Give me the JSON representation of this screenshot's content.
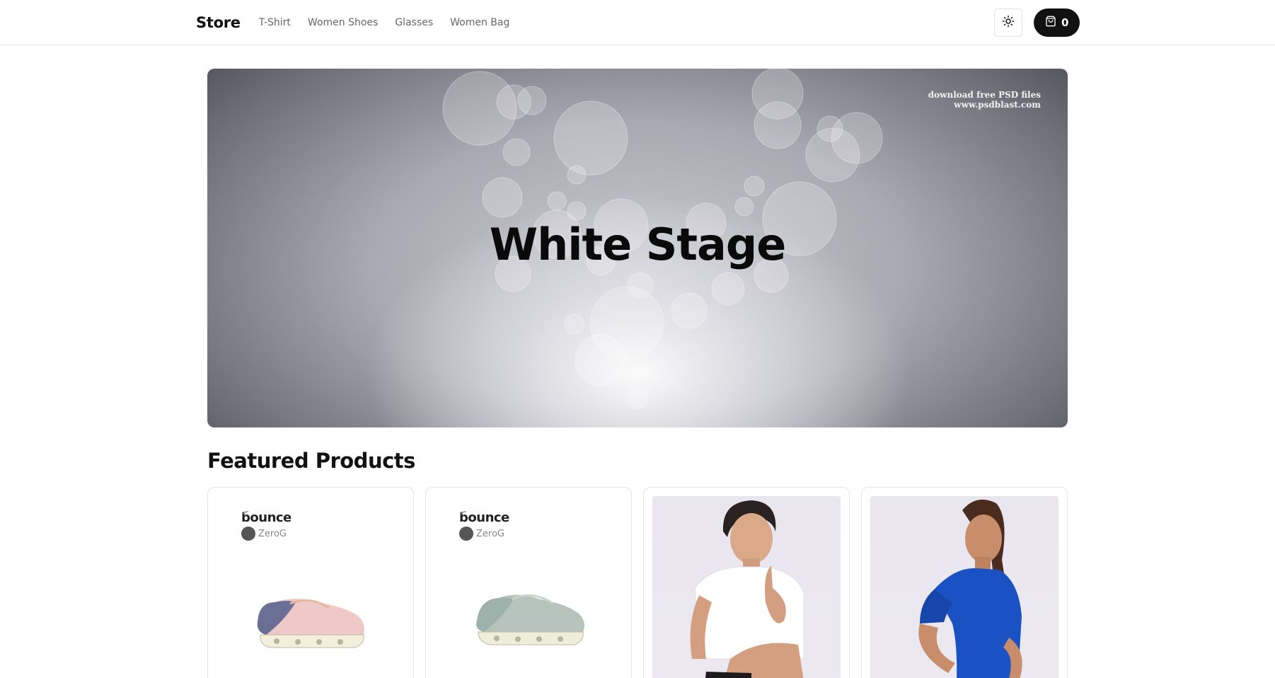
{
  "nav": {
    "brand": "Store",
    "links": [
      "T-Shirt",
      "Women Shoes",
      "Glasses",
      "Women Bag"
    ],
    "theme_icon": "sun-icon",
    "cart_icon": "shopping-bag-icon",
    "cart_count": "0"
  },
  "hero": {
    "title": "White Stage",
    "watermark_line1": "download free PSD files",
    "watermark_line2": "www.psdblast.com"
  },
  "featured": {
    "title": "Featured Products",
    "products": [
      {
        "brand": "bounce",
        "sub_brand": "ZeroG",
        "image": "sneaker-pink-lavender"
      },
      {
        "brand": "bounce",
        "sub_brand": "ZeroG",
        "image": "sneaker-sage-green"
      },
      {
        "image": "man-white-tshirt"
      },
      {
        "image": "woman-blue-tshirt"
      }
    ]
  },
  "colors": {
    "accent": "#111111",
    "nav_link": "#666666",
    "border": "#e5e5e5"
  }
}
